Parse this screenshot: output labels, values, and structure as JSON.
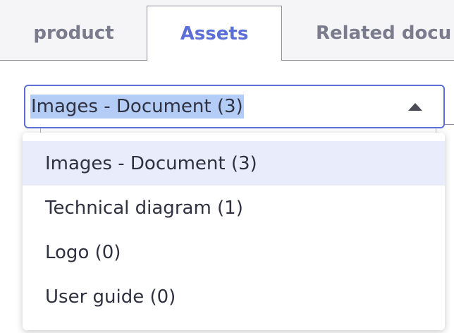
{
  "tabs": [
    {
      "label": "product"
    },
    {
      "label": "Assets"
    },
    {
      "label": "Related docu"
    }
  ],
  "active_tab": "Assets",
  "colors": {
    "accent": "#5b6fd6",
    "selection_highlight": "#b4cdf6",
    "hover": "#e8ecfb"
  },
  "select": {
    "value": "Images - Document (3)",
    "icon": "caret-up-icon",
    "options": [
      {
        "label": "Images - Document (3)"
      },
      {
        "label": "Technical diagram (1)"
      },
      {
        "label": "Logo (0)"
      },
      {
        "label": "User guide (0)"
      }
    ]
  }
}
